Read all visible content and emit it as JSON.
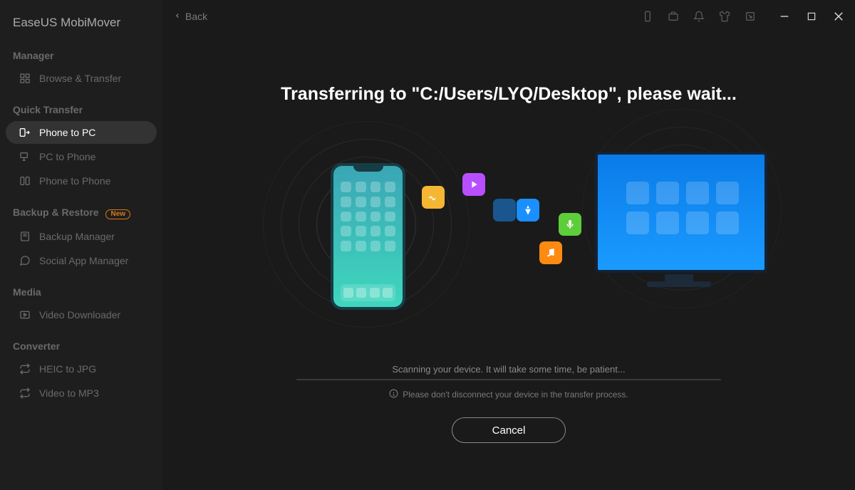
{
  "app": {
    "title": "EaseUS MobiMover"
  },
  "titlebar": {
    "back_label": "Back"
  },
  "sidebar": {
    "sections": {
      "manager": {
        "header": "Manager",
        "items": [
          {
            "label": "Browse & Transfer"
          }
        ]
      },
      "quick_transfer": {
        "header": "Quick Transfer",
        "items": [
          {
            "label": "Phone to PC",
            "active": true
          },
          {
            "label": "PC to Phone"
          },
          {
            "label": "Phone to Phone"
          }
        ]
      },
      "backup_restore": {
        "header": "Backup & Restore",
        "badge": "New",
        "items": [
          {
            "label": "Backup Manager"
          },
          {
            "label": "Social App Manager"
          }
        ]
      },
      "media": {
        "header": "Media",
        "items": [
          {
            "label": "Video Downloader"
          }
        ]
      },
      "converter": {
        "header": "Converter",
        "items": [
          {
            "label": "HEIC to JPG"
          },
          {
            "label": "Video to MP3"
          }
        ]
      }
    }
  },
  "main": {
    "heading": "Transferring to \"C:/Users/LYQ/Desktop\", please wait...",
    "progress_text": "Scanning your device. It will take some time, be patient...",
    "warn_text": "Please don't disconnect your device in the transfer process.",
    "cancel_label": "Cancel"
  }
}
